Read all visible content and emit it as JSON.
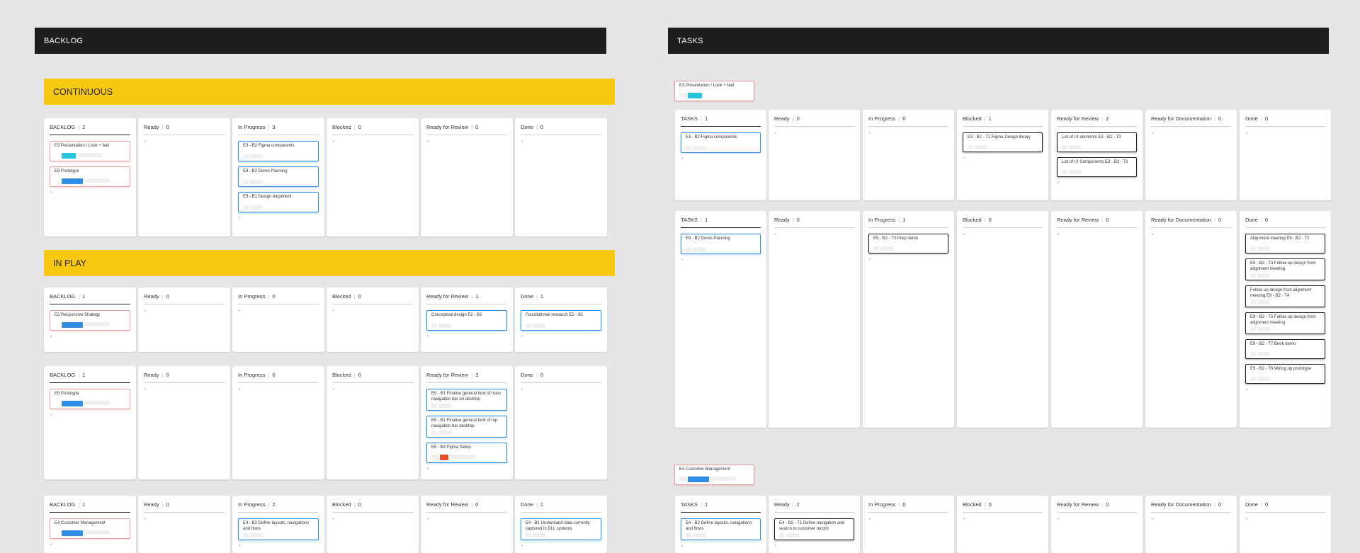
{
  "colors": {
    "accent_yellow": "#f9c812",
    "header_bg": "#1e1e1e",
    "story_border": "#2f8de4",
    "epic_border": "#f0a0a0",
    "teal_tag": "#26c6da",
    "blue_tag": "#2f8de4",
    "red_tag": "#e84c2a"
  },
  "backlog_title": "BACKLOG",
  "tasks_title": "TASKS",
  "continuous_title": "CONTINUOUS",
  "inplay_title": "IN PLAY",
  "add_glyph": "+",
  "sep": "|",
  "float_epics": {
    "e3": "E3 Presentation / Look + feel",
    "e4": "E4 Customer Management"
  },
  "boards": [
    {
      "columns": [
        {
          "name": "BACKLOG",
          "count": "2",
          "cards": [
            {
              "text": "E3 Presentation / Look + feel",
              "kind": "epic",
              "tag": "teal"
            },
            {
              "text": "E9 Prototype",
              "kind": "epic",
              "tag": "blue"
            }
          ]
        },
        {
          "name": "Ready",
          "count": "0",
          "cards": []
        },
        {
          "name": "In Progress",
          "count": "3",
          "cards": [
            {
              "text": "E3 - B2 Figma components",
              "kind": "story"
            },
            {
              "text": "E9 - B2 Demo Planning",
              "kind": "story"
            },
            {
              "text": "E9 - B1 Design Alignment",
              "kind": "story"
            }
          ]
        },
        {
          "name": "Blocked",
          "count": "0",
          "cards": []
        },
        {
          "name": "Ready for Review",
          "count": "0",
          "cards": []
        },
        {
          "name": "Done",
          "count": "0",
          "cards": []
        }
      ]
    },
    {
      "columns": [
        {
          "name": "BACKLOG",
          "count": "1",
          "cards": [
            {
              "text": "E2 Responsive Strategy",
              "kind": "epic",
              "tag": "blue"
            }
          ]
        },
        {
          "name": "Ready",
          "count": "0",
          "cards": []
        },
        {
          "name": "In Progress",
          "count": "0",
          "cards": []
        },
        {
          "name": "Blocked",
          "count": "0",
          "cards": []
        },
        {
          "name": "Ready for Review",
          "count": "1",
          "cards": [
            {
              "text": "Conceptual design E2 - B2",
              "kind": "story"
            }
          ]
        },
        {
          "name": "Done",
          "count": "1",
          "cards": [
            {
              "text": "Foundational research E2 - B1",
              "kind": "story"
            }
          ]
        }
      ]
    },
    {
      "columns": [
        {
          "name": "BACKLOG",
          "count": "1",
          "cards": [
            {
              "text": "E9 Prototype",
              "kind": "epic",
              "tag": "blue"
            }
          ]
        },
        {
          "name": "Ready",
          "count": "0",
          "cards": []
        },
        {
          "name": "In Progress",
          "count": "0",
          "cards": []
        },
        {
          "name": "Blocked",
          "count": "0",
          "cards": []
        },
        {
          "name": "Ready for Review",
          "count": "3",
          "cards": [
            {
              "text": "E9 - B1 Finalise general look of main navigation bar on desktop",
              "kind": "story",
              "tall": true
            },
            {
              "text": "E9 - B1 Finalise general look of top navigation bar desktop",
              "kind": "story",
              "tall": true
            },
            {
              "text": "E9 - B3 Figma Setup",
              "kind": "story",
              "tag": "red"
            }
          ]
        },
        {
          "name": "Done",
          "count": "0",
          "cards": []
        }
      ]
    },
    {
      "columns": [
        {
          "name": "BACKLOG",
          "count": "1",
          "cards": [
            {
              "text": "E4 Customer Management",
              "kind": "epic",
              "tag": "blue"
            }
          ]
        },
        {
          "name": "Ready",
          "count": "0",
          "cards": []
        },
        {
          "name": "In Progress",
          "count": "2",
          "cards": [
            {
              "text": "E4 - B2 Define layouts, navigations and flows",
              "kind": "story",
              "tall": true
            }
          ]
        },
        {
          "name": "Blocked",
          "count": "0",
          "cards": []
        },
        {
          "name": "Ready for Review",
          "count": "0",
          "cards": []
        },
        {
          "name": "Done",
          "count": "1",
          "cards": [
            {
              "text": "E4 - B1 Understand data currently captured in DLL systems",
              "kind": "story",
              "tall": true
            }
          ]
        }
      ]
    },
    {
      "columns": [
        {
          "name": "TASKS",
          "count": "1",
          "cards": [
            {
              "text": "E3 - B2 Figma components",
              "kind": "story"
            }
          ]
        },
        {
          "name": "Ready",
          "count": "0",
          "cards": []
        },
        {
          "name": "In Progress",
          "count": "0",
          "cards": []
        },
        {
          "name": "Blocked",
          "count": "1",
          "cards": [
            {
              "text": "E3 - B2 - T1 Figma Design library",
              "kind": "task"
            }
          ]
        },
        {
          "name": "Ready for Review",
          "count": "2",
          "cards": [
            {
              "text": "List of UI elements E3 - B2 - T2",
              "kind": "task"
            },
            {
              "text": "List of UI Components E3 - B2 - T3",
              "kind": "task"
            }
          ]
        },
        {
          "name": "Ready for Documentation",
          "count": "0",
          "cards": []
        },
        {
          "name": "Done",
          "count": "0",
          "cards": []
        }
      ]
    },
    {
      "columns": [
        {
          "name": "TASKS",
          "count": "1",
          "cards": [
            {
              "text": "E9 - B2 Demo Planning",
              "kind": "story"
            }
          ]
        },
        {
          "name": "Ready",
          "count": "0",
          "cards": []
        },
        {
          "name": "In Progress",
          "count": "1",
          "cards": [
            {
              "text": "E9 - B2 - T3 Prep demo",
              "kind": "task"
            }
          ]
        },
        {
          "name": "Blocked",
          "count": "0",
          "cards": []
        },
        {
          "name": "Ready for Review",
          "count": "0",
          "cards": []
        },
        {
          "name": "Ready for Documentation",
          "count": "0",
          "cards": []
        },
        {
          "name": "Done",
          "count": "6",
          "cards": [
            {
              "text": "Alignment meeting E9 - B2 - T2",
              "kind": "task"
            },
            {
              "text": "E9 - B2 - T3 Follow up design from alignment meeting",
              "kind": "task",
              "tall": true
            },
            {
              "text": "Follow up design from alignment meeting E9 - B2 - T4",
              "kind": "task",
              "tall": true
            },
            {
              "text": "E9 - B2 - T5 Follow up design from alignment meeting",
              "kind": "task",
              "tall": true
            },
            {
              "text": "E9 - B2 - T7 Book demo",
              "kind": "task"
            },
            {
              "text": "E9 - B2 - T6 Wiring up prototype",
              "kind": "task"
            }
          ]
        }
      ]
    },
    {
      "columns": [
        {
          "name": "TASKS",
          "count": "1",
          "cards": [
            {
              "text": "E4 - B2 Define layouts, navigations and flows",
              "kind": "story",
              "tall": true
            }
          ]
        },
        {
          "name": "Ready",
          "count": "2",
          "cards": [
            {
              "text": "E4 - B2 - T1 Define navigation and search to customer record",
              "kind": "task",
              "tall": true
            }
          ]
        },
        {
          "name": "In Progress",
          "count": "0",
          "cards": []
        },
        {
          "name": "Blocked",
          "count": "0",
          "cards": []
        },
        {
          "name": "Ready for Review",
          "count": "0",
          "cards": []
        },
        {
          "name": "Ready for Documentation",
          "count": "0",
          "cards": []
        },
        {
          "name": "Done",
          "count": "0",
          "cards": []
        }
      ]
    }
  ]
}
